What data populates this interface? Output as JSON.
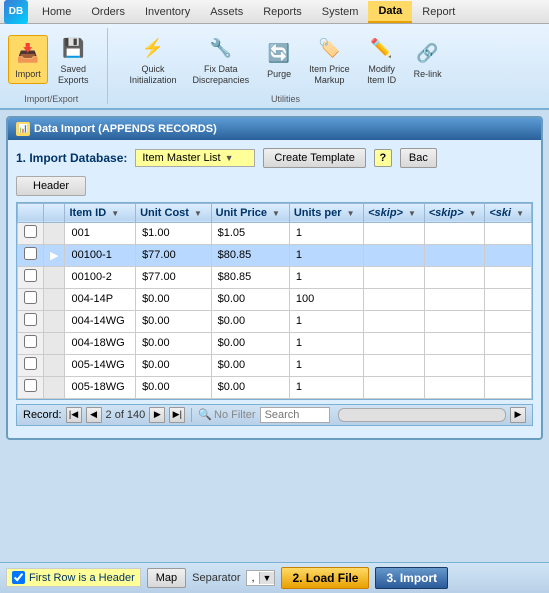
{
  "nav": {
    "app_icon": "DB",
    "items": [
      {
        "label": "Home",
        "active": false
      },
      {
        "label": "Orders",
        "active": false
      },
      {
        "label": "Inventory",
        "active": false
      },
      {
        "label": "Assets",
        "active": false
      },
      {
        "label": "Reports",
        "active": false
      },
      {
        "label": "System",
        "active": false
      },
      {
        "label": "Data",
        "active": true
      },
      {
        "label": "Report",
        "active": false
      }
    ]
  },
  "ribbon": {
    "groups": [
      {
        "label": "Import/Export",
        "buttons": [
          {
            "label": "Import",
            "icon": "📥",
            "active": true
          },
          {
            "label": "Saved\nExports",
            "icon": "💾",
            "active": false
          }
        ]
      },
      {
        "label": "Utilities",
        "buttons": [
          {
            "label": "Quick\nInitialization",
            "icon": "⚡",
            "active": false
          },
          {
            "label": "Fix Data\nDiscrepancies",
            "icon": "🔧",
            "active": false
          },
          {
            "label": "Purge",
            "icon": "🔄",
            "active": false
          },
          {
            "label": "Item Price\nMarkup",
            "icon": "🏷️",
            "active": false
          },
          {
            "label": "Modify\nItem ID",
            "icon": "✏️",
            "active": false
          },
          {
            "label": "Re-link",
            "icon": "🔗",
            "active": false
          }
        ]
      }
    ]
  },
  "dialog": {
    "title": "Data Import (APPENDS RECORDS)",
    "step1_label": "1. Import Database:",
    "dropdown_value": "Item Master List",
    "create_template_label": "Create Template",
    "help_label": "?",
    "back_label": "Bac",
    "header_label": "Header",
    "columns": [
      {
        "label": "Item ID",
        "has_arrow": true
      },
      {
        "label": "Unit Cost",
        "has_arrow": true
      },
      {
        "label": "Unit Price",
        "has_arrow": true
      },
      {
        "label": "Units per",
        "has_arrow": true
      },
      {
        "label": "<skip>",
        "has_arrow": true
      },
      {
        "label": "<skip>",
        "has_arrow": true
      },
      {
        "label": "<ski",
        "has_arrow": true
      }
    ],
    "rows": [
      {
        "marker": "",
        "active": false,
        "item_id": "001",
        "unit_cost": "$1.00",
        "unit_price": "$1.05",
        "units_per": "1",
        "skip1": "",
        "skip2": ""
      },
      {
        "marker": "▶",
        "active": true,
        "item_id": "00100-1",
        "unit_cost": "$77.00",
        "unit_price": "$80.85",
        "units_per": "1",
        "skip1": "",
        "skip2": ""
      },
      {
        "marker": "",
        "active": false,
        "item_id": "00100-2",
        "unit_cost": "$77.00",
        "unit_price": "$80.85",
        "units_per": "1",
        "skip1": "",
        "skip2": ""
      },
      {
        "marker": "",
        "active": false,
        "item_id": "004-14P",
        "unit_cost": "$0.00",
        "unit_price": "$0.00",
        "units_per": "100",
        "skip1": "",
        "skip2": ""
      },
      {
        "marker": "",
        "active": false,
        "item_id": "004-14WG",
        "unit_cost": "$0.00",
        "unit_price": "$0.00",
        "units_per": "1",
        "skip1": "",
        "skip2": ""
      },
      {
        "marker": "",
        "active": false,
        "item_id": "004-18WG",
        "unit_cost": "$0.00",
        "unit_price": "$0.00",
        "units_per": "1",
        "skip1": "",
        "skip2": ""
      },
      {
        "marker": "",
        "active": false,
        "item_id": "005-14WG",
        "unit_cost": "$0.00",
        "unit_price": "$0.00",
        "units_per": "1",
        "skip1": "",
        "skip2": ""
      },
      {
        "marker": "",
        "active": false,
        "item_id": "005-18WG",
        "unit_cost": "$0.00",
        "unit_price": "$0.00",
        "units_per": "1",
        "skip1": "",
        "skip2": ""
      }
    ],
    "nav_record_label": "Record:",
    "nav_current": "2 of 140",
    "nav_filter": "No Filter",
    "nav_search_placeholder": "Search",
    "first_row_header_label": "First Row is a Header",
    "map_label": "Map",
    "separator_label": "Separator",
    "separator_value": ",",
    "load_file_label": "2. Load File",
    "import_label": "3. Import"
  }
}
